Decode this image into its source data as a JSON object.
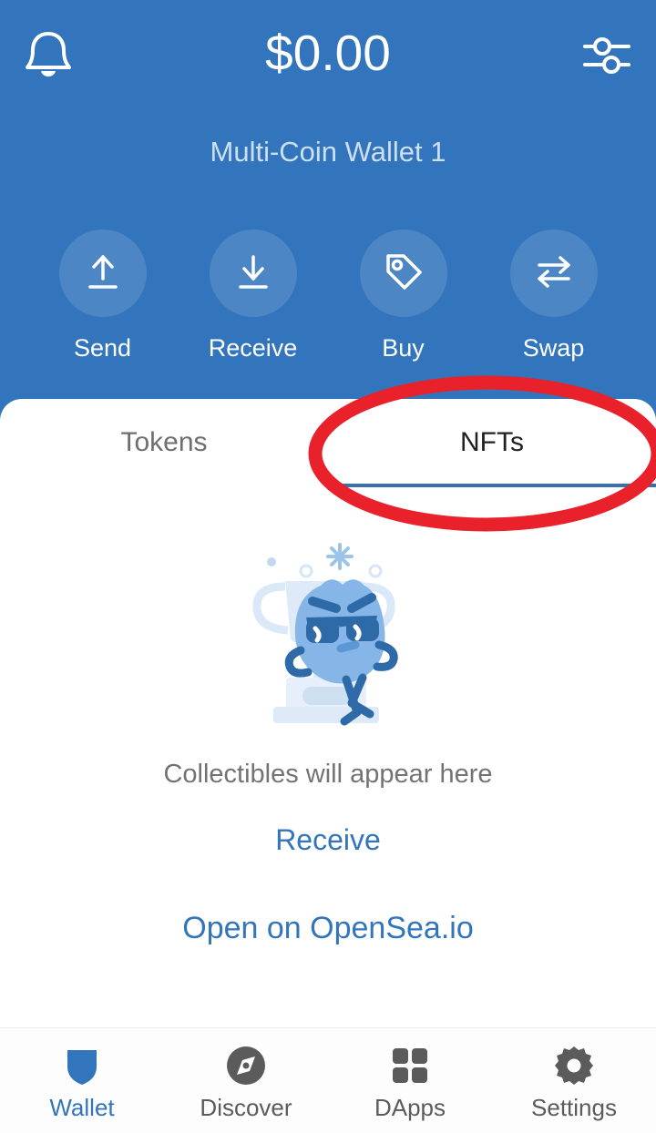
{
  "header": {
    "balance": "$0.00",
    "wallet_name": "Multi-Coin Wallet 1",
    "notifications_icon": "bell-icon",
    "settings_icon": "sliders-icon",
    "background_color": "#3275bc",
    "actions": [
      {
        "label": "Send",
        "icon": "arrow-up-upload-icon"
      },
      {
        "label": "Receive",
        "icon": "arrow-down-download-icon"
      },
      {
        "label": "Buy",
        "icon": "price-tag-icon"
      },
      {
        "label": "Swap",
        "icon": "swap-arrows-icon"
      }
    ]
  },
  "tabs": {
    "items": [
      {
        "label": "Tokens",
        "active": false
      },
      {
        "label": "NFTs",
        "active": true
      }
    ],
    "active_indicator_color": "#3a71ad"
  },
  "empty_state": {
    "illustration": "blob-character-with-trophy-illustration",
    "title": "Collectibles will appear here",
    "primary_link": "Receive",
    "secondary_link": "Open on OpenSea.io",
    "link_color": "#3275bc"
  },
  "bottom_nav": {
    "items": [
      {
        "label": "Wallet",
        "icon": "shield-icon",
        "active": true
      },
      {
        "label": "Discover",
        "icon": "compass-icon",
        "active": false
      },
      {
        "label": "DApps",
        "icon": "grid-squares-icon",
        "active": false
      },
      {
        "label": "Settings",
        "icon": "gear-icon",
        "active": false
      }
    ],
    "active_color": "#3275bc",
    "inactive_color": "#5b5b5b"
  },
  "annotation": {
    "shape": "ellipse-highlight",
    "color": "#e8212a",
    "target": "NFTs"
  }
}
